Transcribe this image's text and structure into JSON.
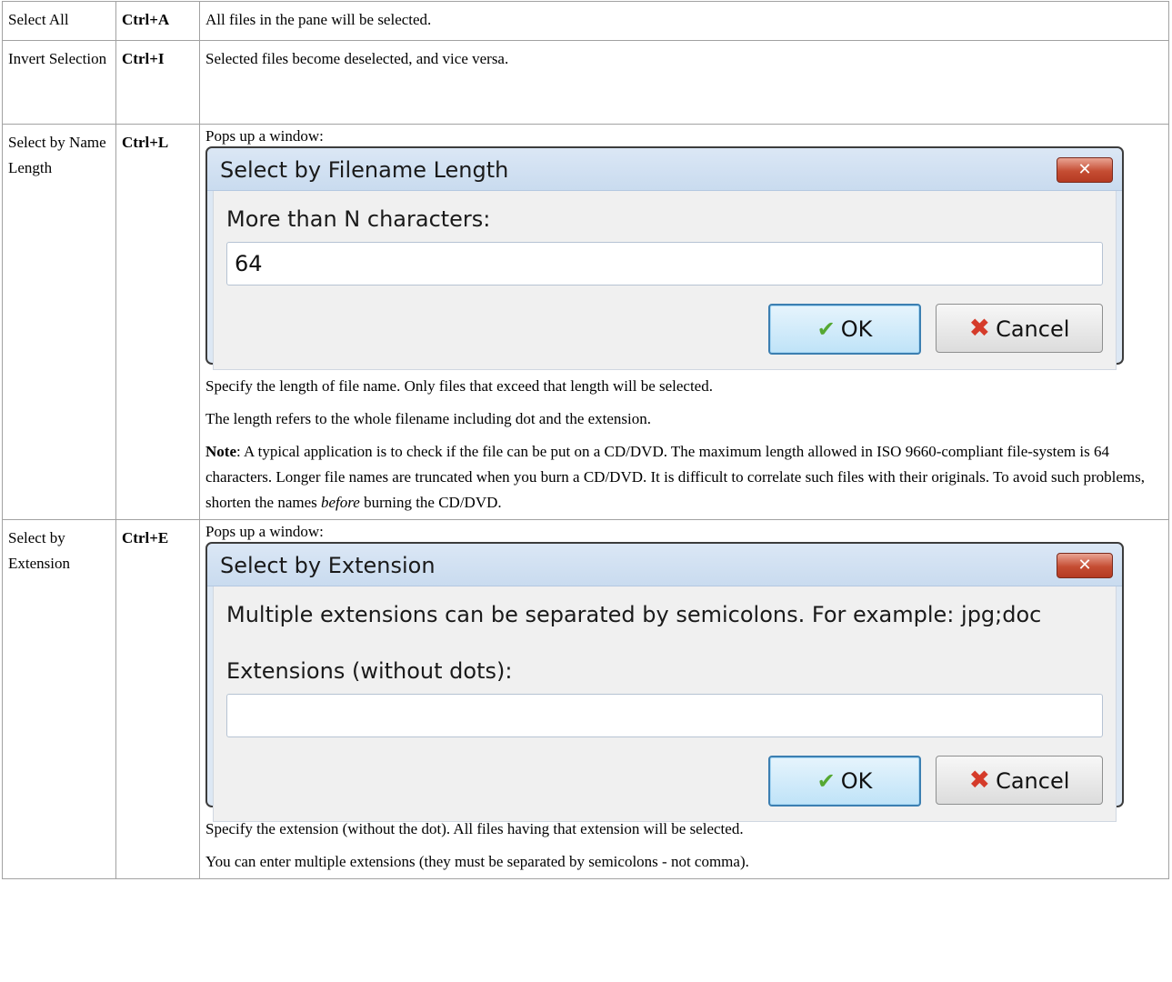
{
  "rows": [
    {
      "command": "Select All",
      "shortcut": "Ctrl+A",
      "description": "All files in the pane will be selected."
    },
    {
      "command": "Invert Selection",
      "shortcut": "Ctrl+I",
      "description": "Selected files become deselected, and vice versa."
    },
    {
      "command": "Select by Name Length",
      "shortcut": "Ctrl+L",
      "intro": "Pops up a window:",
      "dialog": {
        "title": "Select by Filename Length",
        "close_label": "✕",
        "field_label": "More than N characters:",
        "field_value": "64",
        "ok_label": "OK",
        "cancel_label": "Cancel"
      },
      "para1": "Specify the length of file name. Only files that exceed that length will be selected.",
      "para2": "The length refers to the whole filename including dot and the extension.",
      "note_label": "Note",
      "note_text_1": ": A typical application is to check if the file can be put on a CD/DVD. The maximum length allowed in ISO 9660-compliant file-system is 64 characters. Longer file names are truncated when you burn a CD/DVD. It is difficult to correlate such files with their originals. To avoid such problems, shorten the names ",
      "note_emph": "before",
      "note_text_2": " burning the CD/DVD."
    },
    {
      "command": "Select by Extension",
      "shortcut": "Ctrl+E",
      "intro": "Pops up a window:",
      "dialog": {
        "title": "Select by Extension",
        "close_label": "✕",
        "hint": "Multiple extensions can be separated by semicolons. For example: jpg;doc",
        "field_label": "Extensions (without dots):",
        "field_value": "",
        "ok_label": "OK",
        "cancel_label": "Cancel"
      },
      "para1": "Specify the extension (without the dot). All files having that extension will be selected.",
      "para2": "You can enter multiple extensions (they must be separated by semicolons - not comma)."
    }
  ],
  "icons": {
    "ok": "checkmark-icon",
    "cancel": "red-x-icon"
  }
}
